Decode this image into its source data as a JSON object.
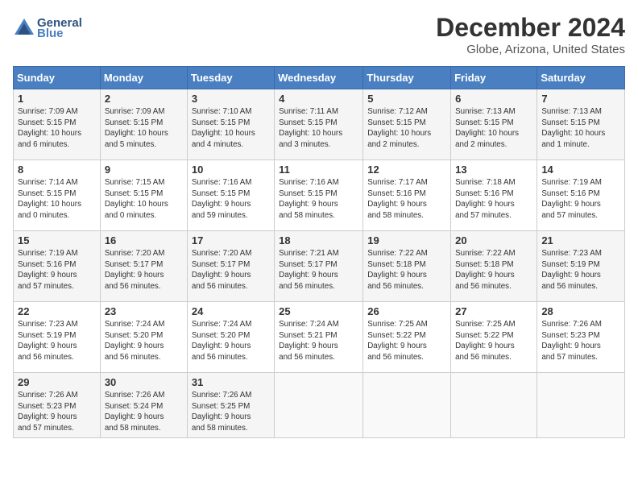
{
  "header": {
    "logo_line1": "General",
    "logo_line2": "Blue",
    "month": "December 2024",
    "location": "Globe, Arizona, United States"
  },
  "weekdays": [
    "Sunday",
    "Monday",
    "Tuesday",
    "Wednesday",
    "Thursday",
    "Friday",
    "Saturday"
  ],
  "weeks": [
    [
      {
        "day": "1",
        "info": "Sunrise: 7:09 AM\nSunset: 5:15 PM\nDaylight: 10 hours\nand 6 minutes."
      },
      {
        "day": "2",
        "info": "Sunrise: 7:09 AM\nSunset: 5:15 PM\nDaylight: 10 hours\nand 5 minutes."
      },
      {
        "day": "3",
        "info": "Sunrise: 7:10 AM\nSunset: 5:15 PM\nDaylight: 10 hours\nand 4 minutes."
      },
      {
        "day": "4",
        "info": "Sunrise: 7:11 AM\nSunset: 5:15 PM\nDaylight: 10 hours\nand 3 minutes."
      },
      {
        "day": "5",
        "info": "Sunrise: 7:12 AM\nSunset: 5:15 PM\nDaylight: 10 hours\nand 2 minutes."
      },
      {
        "day": "6",
        "info": "Sunrise: 7:13 AM\nSunset: 5:15 PM\nDaylight: 10 hours\nand 2 minutes."
      },
      {
        "day": "7",
        "info": "Sunrise: 7:13 AM\nSunset: 5:15 PM\nDaylight: 10 hours\nand 1 minute."
      }
    ],
    [
      {
        "day": "8",
        "info": "Sunrise: 7:14 AM\nSunset: 5:15 PM\nDaylight: 10 hours\nand 0 minutes."
      },
      {
        "day": "9",
        "info": "Sunrise: 7:15 AM\nSunset: 5:15 PM\nDaylight: 10 hours\nand 0 minutes."
      },
      {
        "day": "10",
        "info": "Sunrise: 7:16 AM\nSunset: 5:15 PM\nDaylight: 9 hours\nand 59 minutes."
      },
      {
        "day": "11",
        "info": "Sunrise: 7:16 AM\nSunset: 5:15 PM\nDaylight: 9 hours\nand 58 minutes."
      },
      {
        "day": "12",
        "info": "Sunrise: 7:17 AM\nSunset: 5:16 PM\nDaylight: 9 hours\nand 58 minutes."
      },
      {
        "day": "13",
        "info": "Sunrise: 7:18 AM\nSunset: 5:16 PM\nDaylight: 9 hours\nand 57 minutes."
      },
      {
        "day": "14",
        "info": "Sunrise: 7:19 AM\nSunset: 5:16 PM\nDaylight: 9 hours\nand 57 minutes."
      }
    ],
    [
      {
        "day": "15",
        "info": "Sunrise: 7:19 AM\nSunset: 5:16 PM\nDaylight: 9 hours\nand 57 minutes."
      },
      {
        "day": "16",
        "info": "Sunrise: 7:20 AM\nSunset: 5:17 PM\nDaylight: 9 hours\nand 56 minutes."
      },
      {
        "day": "17",
        "info": "Sunrise: 7:20 AM\nSunset: 5:17 PM\nDaylight: 9 hours\nand 56 minutes."
      },
      {
        "day": "18",
        "info": "Sunrise: 7:21 AM\nSunset: 5:17 PM\nDaylight: 9 hours\nand 56 minutes."
      },
      {
        "day": "19",
        "info": "Sunrise: 7:22 AM\nSunset: 5:18 PM\nDaylight: 9 hours\nand 56 minutes."
      },
      {
        "day": "20",
        "info": "Sunrise: 7:22 AM\nSunset: 5:18 PM\nDaylight: 9 hours\nand 56 minutes."
      },
      {
        "day": "21",
        "info": "Sunrise: 7:23 AM\nSunset: 5:19 PM\nDaylight: 9 hours\nand 56 minutes."
      }
    ],
    [
      {
        "day": "22",
        "info": "Sunrise: 7:23 AM\nSunset: 5:19 PM\nDaylight: 9 hours\nand 56 minutes."
      },
      {
        "day": "23",
        "info": "Sunrise: 7:24 AM\nSunset: 5:20 PM\nDaylight: 9 hours\nand 56 minutes."
      },
      {
        "day": "24",
        "info": "Sunrise: 7:24 AM\nSunset: 5:20 PM\nDaylight: 9 hours\nand 56 minutes."
      },
      {
        "day": "25",
        "info": "Sunrise: 7:24 AM\nSunset: 5:21 PM\nDaylight: 9 hours\nand 56 minutes."
      },
      {
        "day": "26",
        "info": "Sunrise: 7:25 AM\nSunset: 5:22 PM\nDaylight: 9 hours\nand 56 minutes."
      },
      {
        "day": "27",
        "info": "Sunrise: 7:25 AM\nSunset: 5:22 PM\nDaylight: 9 hours\nand 56 minutes."
      },
      {
        "day": "28",
        "info": "Sunrise: 7:26 AM\nSunset: 5:23 PM\nDaylight: 9 hours\nand 57 minutes."
      }
    ],
    [
      {
        "day": "29",
        "info": "Sunrise: 7:26 AM\nSunset: 5:23 PM\nDaylight: 9 hours\nand 57 minutes."
      },
      {
        "day": "30",
        "info": "Sunrise: 7:26 AM\nSunset: 5:24 PM\nDaylight: 9 hours\nand 58 minutes."
      },
      {
        "day": "31",
        "info": "Sunrise: 7:26 AM\nSunset: 5:25 PM\nDaylight: 9 hours\nand 58 minutes."
      },
      {
        "day": "",
        "info": ""
      },
      {
        "day": "",
        "info": ""
      },
      {
        "day": "",
        "info": ""
      },
      {
        "day": "",
        "info": ""
      }
    ]
  ]
}
